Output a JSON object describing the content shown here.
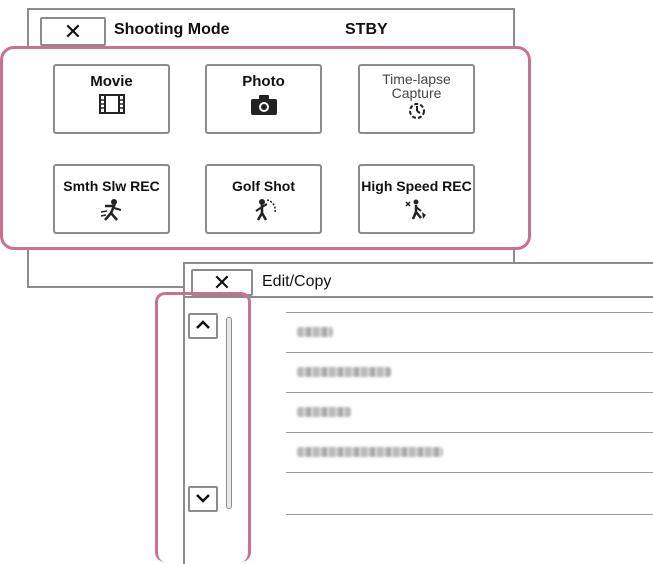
{
  "shooting_mode": {
    "close_label": "✕",
    "title": "Shooting Mode",
    "status": "STBY",
    "modes": [
      {
        "label": "Movie",
        "icon": "film-strip-icon"
      },
      {
        "label": "Photo",
        "icon": "camera-icon"
      },
      {
        "label": "Time-lapse Capture",
        "icon": "timelapse-icon"
      },
      {
        "label": "Smth Slw REC",
        "icon": "slow-motion-icon"
      },
      {
        "label": "Golf Shot",
        "icon": "golf-swing-icon"
      },
      {
        "label": "High Speed REC",
        "icon": "high-speed-icon"
      }
    ],
    "highlight_color": "#cc6f91"
  },
  "edit_copy": {
    "close_label": "✕",
    "title": "Edit/Copy",
    "scroll_up_icon": "chevron-up-icon",
    "scroll_down_icon": "chevron-down-icon",
    "highlight_color": "#cc6f91"
  }
}
